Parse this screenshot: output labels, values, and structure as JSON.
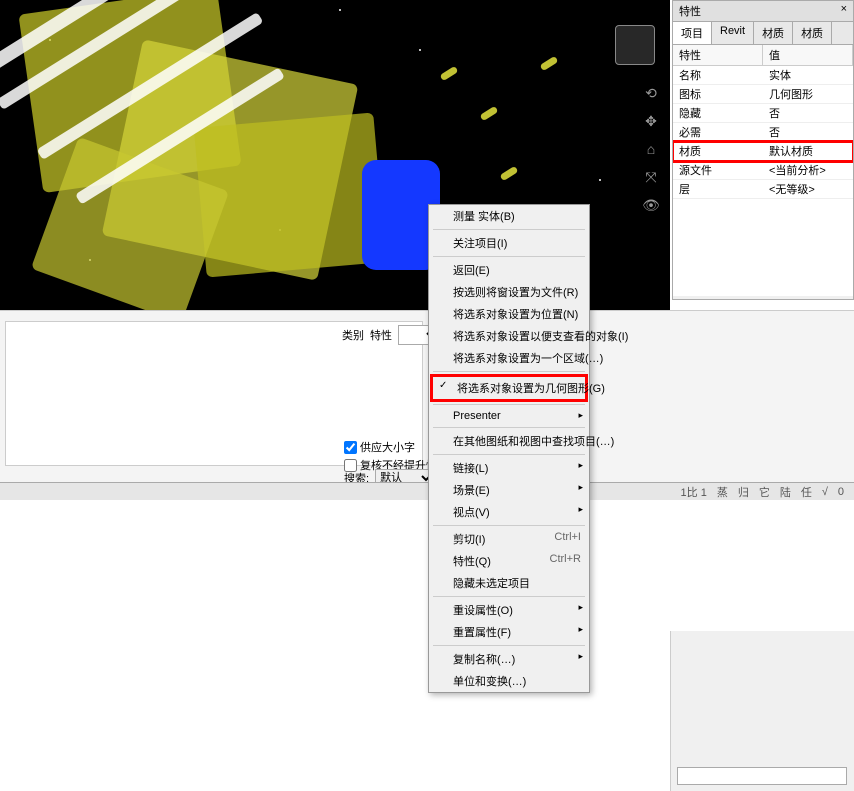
{
  "viewport": {
    "nav_tools": [
      "⟲",
      "✥",
      "⌂",
      "⤧",
      "👁"
    ]
  },
  "context_menu": {
    "items": [
      {
        "label": "测量 实体(B)",
        "sep_after": true
      },
      {
        "label": "关注项目(I)",
        "sep_after": true
      },
      {
        "label": "返回(E)"
      },
      {
        "label": "按选则将窗设置为文件(R)"
      },
      {
        "label": "将选系对象设置为位置(N)"
      },
      {
        "label": "将选系对象设置以便支查看的对象(I)"
      },
      {
        "label": "将选系对象设置为一个区域(…)",
        "sep_after": true
      },
      {
        "label": "将选系对象设置为几何图形(G)",
        "highlight": true,
        "checked": true,
        "sep_after": true
      },
      {
        "label": "Presenter",
        "submenu": true,
        "sep_after": true
      },
      {
        "label": "在其他图纸和视图中查找项目(…)",
        "sep_after": true
      },
      {
        "label": "链接(L)",
        "submenu": true
      },
      {
        "label": "场景(E)",
        "submenu": true
      },
      {
        "label": "视点(V)",
        "submenu": true,
        "sep_after": true
      },
      {
        "label": "剪切(I)",
        "shortcut": "Ctrl+I"
      },
      {
        "label": "特性(Q)",
        "shortcut": "Ctrl+R"
      },
      {
        "label": "隐藏未选定项目",
        "sep_after": true
      },
      {
        "label": "重设属性(O)",
        "submenu": true
      },
      {
        "label": "重置属性(F)",
        "submenu": true,
        "sep_after": true
      },
      {
        "label": "复制名称(…)",
        "submenu": true
      },
      {
        "label": "单位和变换(…)"
      }
    ]
  },
  "properties": {
    "title": "特性",
    "close": "×",
    "tabs": [
      "项目",
      "Revit",
      "材质",
      "材质"
    ],
    "columns": [
      "特性",
      "值"
    ],
    "rows": [
      {
        "k": "名称",
        "v": "实体"
      },
      {
        "k": "图标",
        "v": "几何图形"
      },
      {
        "k": "隐藏",
        "v": "否"
      },
      {
        "k": "必需",
        "v": "否"
      },
      {
        "k": "材质",
        "v": "默认材质",
        "hi": true
      },
      {
        "k": "源文件",
        "v": "<当前分析>"
      },
      {
        "k": "层",
        "v": "<无等级>"
      }
    ]
  },
  "bottom": {
    "label_category": "类别",
    "label_special": "特性",
    "check1": "供应大小字",
    "check2": "复核不经提升性果",
    "search_label": "搜索:",
    "search_value": "默认"
  },
  "status": {
    "items": [
      "1比 1",
      "蒸",
      "归",
      "它",
      "陆",
      "任",
      "√",
      "0"
    ]
  }
}
